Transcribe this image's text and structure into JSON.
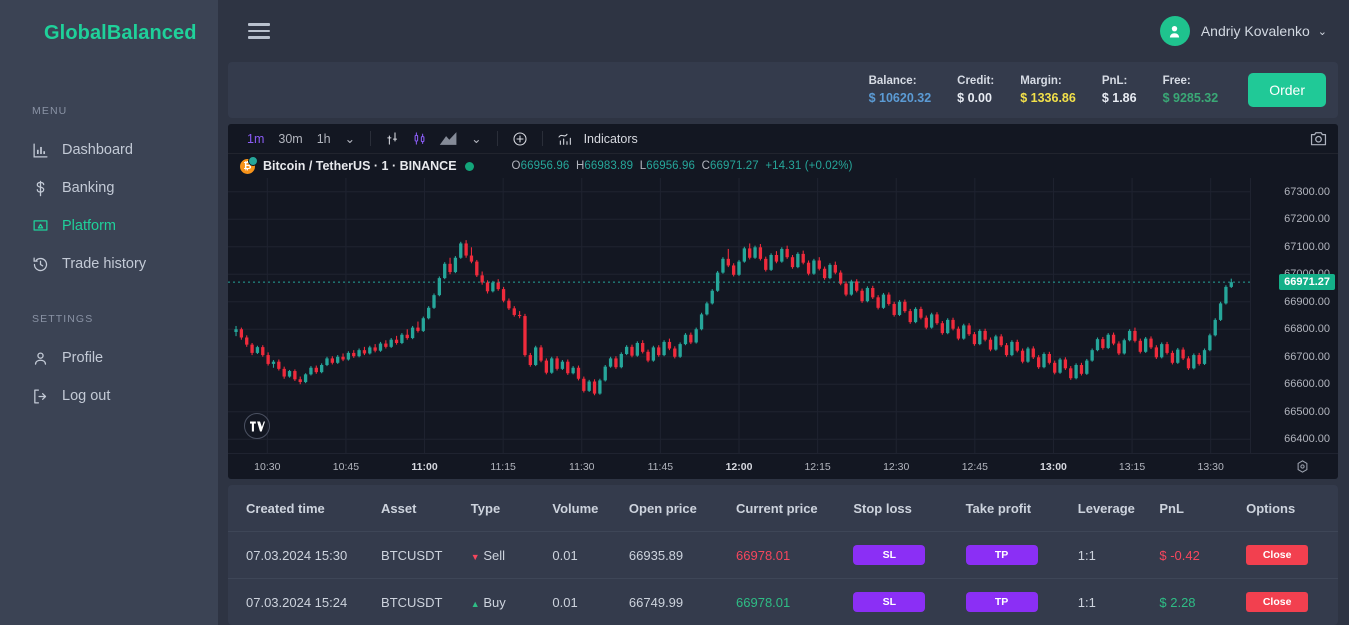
{
  "brand": {
    "name": "GlobalBalanced"
  },
  "header": {
    "menu_icon": "hamburger-icon",
    "user_name": "Andriy Kovalenko",
    "caret": "⌄"
  },
  "sidebar": {
    "sections": [
      {
        "label": "MENU"
      },
      {
        "label": "SETTINGS"
      }
    ],
    "menu_items": [
      {
        "label": "Dashboard",
        "icon": "bar-chart-icon",
        "active": false
      },
      {
        "label": "Banking",
        "icon": "dollar-icon",
        "active": false
      },
      {
        "label": "Platform",
        "icon": "monitor-icon",
        "active": true
      },
      {
        "label": "Trade history",
        "icon": "history-icon",
        "active": false
      }
    ],
    "settings_items": [
      {
        "label": "Profile",
        "icon": "user-icon",
        "active": false
      },
      {
        "label": "Log out",
        "icon": "logout-icon",
        "active": false
      }
    ]
  },
  "stats": {
    "items": [
      {
        "label": "Balance:",
        "value": "$ 10620.32",
        "color": "#5b9bd5"
      },
      {
        "label": "Credit:",
        "value": "$ 0.00",
        "color": "#e8ecf3"
      },
      {
        "label": "Margin:",
        "value": "$ 1336.86",
        "color": "#f2e04a"
      },
      {
        "label": "PnL:",
        "value": "$ 1.86",
        "color": "#e8ecf3"
      },
      {
        "label": "Free:",
        "value": "$ 9285.32",
        "color": "#3aa876"
      }
    ],
    "order_button": "Order"
  },
  "chart_toolbar": {
    "timeframes": [
      {
        "label": "1m",
        "active": true
      },
      {
        "label": "30m",
        "active": false
      },
      {
        "label": "1h",
        "active": false
      }
    ],
    "chevron": "⌄",
    "icons": [
      "compare-icon",
      "candlestick-icon",
      "area-chart-icon",
      "add-icon"
    ],
    "indicators_label": "Indicators",
    "indicators_icon": "indicators-icon",
    "camera_icon": "camera-icon"
  },
  "symbol": {
    "coin_icon": "bitcoin-icon",
    "name": "Bitcoin / TetherUS · 1 · BINANCE",
    "status": "market-open-dot",
    "ohlc": {
      "o_key": "O",
      "o": "66956.96",
      "h_key": "H",
      "h": "66983.89",
      "l_key": "L",
      "l": "66956.96",
      "c_key": "C",
      "c": "66971.27",
      "change": "+14.31 (+0.02%)"
    }
  },
  "chart_data": {
    "type": "candlestick",
    "title": "Bitcoin / TetherUS · 1 · BINANCE",
    "xlabel": "",
    "ylabel": "",
    "grid": true,
    "legend": "none",
    "ylim": [
      66350,
      67350
    ],
    "price_ticks": [
      "67300.00",
      "67200.00",
      "67100.00",
      "67000.00",
      "66900.00",
      "66800.00",
      "66700.00",
      "66600.00",
      "66500.00",
      "66400.00"
    ],
    "time_ticks": [
      {
        "label": "10:30",
        "bold": false
      },
      {
        "label": "10:45",
        "bold": false
      },
      {
        "label": "11:00",
        "bold": true
      },
      {
        "label": "11:15",
        "bold": false
      },
      {
        "label": "11:30",
        "bold": false
      },
      {
        "label": "11:45",
        "bold": false
      },
      {
        "label": "12:00",
        "bold": true
      },
      {
        "label": "12:15",
        "bold": false
      },
      {
        "label": "12:30",
        "bold": false
      },
      {
        "label": "12:45",
        "bold": false
      },
      {
        "label": "13:00",
        "bold": true
      },
      {
        "label": "13:15",
        "bold": false
      },
      {
        "label": "13:30",
        "bold": false
      }
    ],
    "current_price": 66971.27,
    "current_price_label": "66971.27",
    "up_color": "#26a69a",
    "down_color": "#ef2b3c",
    "background": "#131722",
    "candles": [
      [
        66790,
        66812,
        66775,
        66800
      ],
      [
        66800,
        66806,
        66762,
        66770
      ],
      [
        66770,
        66778,
        66736,
        66744
      ],
      [
        66744,
        66750,
        66706,
        66714
      ],
      [
        66714,
        66740,
        66710,
        66735
      ],
      [
        66735,
        66742,
        66700,
        66706
      ],
      [
        66706,
        66716,
        66668,
        66674
      ],
      [
        66674,
        66688,
        66660,
        66682
      ],
      [
        66682,
        66690,
        66650,
        66656
      ],
      [
        66656,
        66664,
        66620,
        66628
      ],
      [
        66628,
        66652,
        66624,
        66648
      ],
      [
        66648,
        66654,
        66612,
        66618
      ],
      [
        66618,
        66628,
        66600,
        66608
      ],
      [
        66608,
        66640,
        66604,
        66636
      ],
      [
        66636,
        66666,
        66632,
        66660
      ],
      [
        66660,
        66668,
        66638,
        66644
      ],
      [
        66644,
        66676,
        66640,
        66670
      ],
      [
        66670,
        66700,
        66666,
        66694
      ],
      [
        66694,
        66702,
        66672,
        66678
      ],
      [
        66678,
        66706,
        66674,
        66700
      ],
      [
        66700,
        66712,
        66684,
        66690
      ],
      [
        66690,
        66720,
        66686,
        66714
      ],
      [
        66714,
        66724,
        66696,
        66702
      ],
      [
        66702,
        66730,
        66698,
        66724
      ],
      [
        66724,
        66736,
        66706,
        66712
      ],
      [
        66712,
        66740,
        66708,
        66734
      ],
      [
        66734,
        66746,
        66716,
        66722
      ],
      [
        66722,
        66754,
        66718,
        66748
      ],
      [
        66748,
        66760,
        66730,
        66736
      ],
      [
        66736,
        66768,
        66732,
        66762
      ],
      [
        66762,
        66776,
        66744,
        66750
      ],
      [
        66750,
        66786,
        66746,
        66780
      ],
      [
        66780,
        66800,
        66762,
        66768
      ],
      [
        66768,
        66812,
        66764,
        66806
      ],
      [
        66806,
        66828,
        66788,
        66794
      ],
      [
        66794,
        66846,
        66790,
        66840
      ],
      [
        66840,
        66884,
        66836,
        66878
      ],
      [
        66878,
        66930,
        66874,
        66924
      ],
      [
        66924,
        66992,
        66920,
        66986
      ],
      [
        66986,
        67044,
        66982,
        67038
      ],
      [
        67038,
        67060,
        67000,
        67008
      ],
      [
        67008,
        67066,
        67004,
        67060
      ],
      [
        67060,
        67118,
        67056,
        67112
      ],
      [
        67112,
        67124,
        67060,
        67068
      ],
      [
        67068,
        67098,
        67040,
        67046
      ],
      [
        67046,
        67052,
        66990,
        66996
      ],
      [
        66996,
        67010,
        66962,
        66970
      ],
      [
        66970,
        66978,
        66930,
        66938
      ],
      [
        66938,
        66976,
        66934,
        66970
      ],
      [
        66970,
        66982,
        66940,
        66946
      ],
      [
        66946,
        66954,
        66898,
        66904
      ],
      [
        66904,
        66912,
        66870,
        66876
      ],
      [
        66876,
        66884,
        66846,
        66852
      ],
      [
        66852,
        66866,
        66840,
        66848
      ],
      [
        66848,
        66856,
        66700,
        66706
      ],
      [
        66706,
        66714,
        66664,
        66670
      ],
      [
        66670,
        66740,
        66666,
        66734
      ],
      [
        66734,
        66742,
        66680,
        66686
      ],
      [
        66686,
        66694,
        66636,
        66642
      ],
      [
        66642,
        66700,
        66638,
        66694
      ],
      [
        66694,
        66702,
        66650,
        66656
      ],
      [
        66656,
        66688,
        66652,
        66682
      ],
      [
        66682,
        66690,
        66634,
        66640
      ],
      [
        66640,
        66666,
        66636,
        66660
      ],
      [
        66660,
        66668,
        66614,
        66620
      ],
      [
        66620,
        66628,
        66570,
        66576
      ],
      [
        66576,
        66616,
        66572,
        66610
      ],
      [
        66610,
        66618,
        66560,
        66566
      ],
      [
        66566,
        66620,
        66562,
        66614
      ],
      [
        66614,
        66670,
        66610,
        66664
      ],
      [
        66664,
        66700,
        66660,
        66694
      ],
      [
        66694,
        66702,
        66656,
        66662
      ],
      [
        66662,
        66716,
        66658,
        66710
      ],
      [
        66710,
        66742,
        66706,
        66736
      ],
      [
        66736,
        66744,
        66698,
        66704
      ],
      [
        66704,
        66756,
        66700,
        66750
      ],
      [
        66750,
        66760,
        66712,
        66718
      ],
      [
        66718,
        66726,
        66680,
        66686
      ],
      [
        66686,
        66740,
        66682,
        66734
      ],
      [
        66734,
        66742,
        66700,
        66706
      ],
      [
        66706,
        66760,
        66702,
        66754
      ],
      [
        66754,
        66766,
        66724,
        66730
      ],
      [
        66730,
        66738,
        66694,
        66700
      ],
      [
        66700,
        66752,
        66696,
        66746
      ],
      [
        66746,
        66786,
        66742,
        66780
      ],
      [
        66780,
        66788,
        66746,
        66752
      ],
      [
        66752,
        66806,
        66748,
        66800
      ],
      [
        66800,
        66860,
        66796,
        66854
      ],
      [
        66854,
        66900,
        66850,
        66894
      ],
      [
        66894,
        66946,
        66890,
        66940
      ],
      [
        66940,
        67012,
        66936,
        67006
      ],
      [
        67006,
        67062,
        67002,
        67056
      ],
      [
        67056,
        67092,
        67026,
        67032
      ],
      [
        67032,
        67040,
        66992,
        66998
      ],
      [
        66998,
        67052,
        66994,
        67046
      ],
      [
        67046,
        67100,
        67042,
        67094
      ],
      [
        67094,
        67112,
        67054,
        67060
      ],
      [
        67060,
        67104,
        67056,
        67098
      ],
      [
        67098,
        67110,
        67050,
        67056
      ],
      [
        67056,
        67064,
        67010,
        67016
      ],
      [
        67016,
        67076,
        67012,
        67070
      ],
      [
        67070,
        67084,
        67040,
        67046
      ],
      [
        67046,
        67098,
        67042,
        67092
      ],
      [
        67092,
        67104,
        67056,
        67062
      ],
      [
        67062,
        67070,
        67020,
        67026
      ],
      [
        67026,
        67080,
        67022,
        67074
      ],
      [
        67074,
        67086,
        67036,
        67042
      ],
      [
        67042,
        67050,
        66996,
        67002
      ],
      [
        67002,
        67056,
        66998,
        67050
      ],
      [
        67050,
        67062,
        67014,
        67020
      ],
      [
        67020,
        67028,
        66980,
        66986
      ],
      [
        66986,
        67040,
        66982,
        67034
      ],
      [
        67034,
        67046,
        67000,
        67006
      ],
      [
        67006,
        67014,
        66960,
        66966
      ],
      [
        66966,
        66974,
        66920,
        66926
      ],
      [
        66926,
        66980,
        66922,
        66974
      ],
      [
        66974,
        66982,
        66934,
        66940
      ],
      [
        66940,
        66948,
        66896,
        66902
      ],
      [
        66902,
        66956,
        66898,
        66950
      ],
      [
        66950,
        66958,
        66910,
        66916
      ],
      [
        66916,
        66924,
        66872,
        66878
      ],
      [
        66878,
        66932,
        66874,
        66926
      ],
      [
        66926,
        66934,
        66886,
        66892
      ],
      [
        66892,
        66900,
        66846,
        66852
      ],
      [
        66852,
        66906,
        66848,
        66900
      ],
      [
        66900,
        66908,
        66860,
        66866
      ],
      [
        66866,
        66874,
        66820,
        66826
      ],
      [
        66826,
        66880,
        66822,
        66874
      ],
      [
        66874,
        66882,
        66836,
        66842
      ],
      [
        66842,
        66850,
        66800,
        66806
      ],
      [
        66806,
        66860,
        66802,
        66854
      ],
      [
        66854,
        66862,
        66816,
        66822
      ],
      [
        66822,
        66830,
        66780,
        66786
      ],
      [
        66786,
        66840,
        66782,
        66834
      ],
      [
        66834,
        66842,
        66796,
        66802
      ],
      [
        66802,
        66810,
        66760,
        66766
      ],
      [
        66766,
        66820,
        66762,
        66814
      ],
      [
        66814,
        66822,
        66776,
        66782
      ],
      [
        66782,
        66790,
        66740,
        66746
      ],
      [
        66746,
        66800,
        66742,
        66794
      ],
      [
        66794,
        66802,
        66756,
        66762
      ],
      [
        66762,
        66770,
        66720,
        66726
      ],
      [
        66726,
        66780,
        66722,
        66774
      ],
      [
        66774,
        66782,
        66736,
        66742
      ],
      [
        66742,
        66750,
        66700,
        66706
      ],
      [
        66706,
        66760,
        66702,
        66754
      ],
      [
        66754,
        66762,
        66716,
        66722
      ],
      [
        66722,
        66730,
        66676,
        66682
      ],
      [
        66682,
        66736,
        66678,
        66730
      ],
      [
        66730,
        66738,
        66692,
        66698
      ],
      [
        66698,
        66706,
        66656,
        66662
      ],
      [
        66662,
        66716,
        66658,
        66710
      ],
      [
        66710,
        66718,
        66672,
        66678
      ],
      [
        66678,
        66686,
        66636,
        66642
      ],
      [
        66642,
        66696,
        66638,
        66690
      ],
      [
        66690,
        66698,
        66652,
        66658
      ],
      [
        66658,
        66666,
        66616,
        66622
      ],
      [
        66622,
        66676,
        66618,
        66670
      ],
      [
        66670,
        66678,
        66632,
        66638
      ],
      [
        66638,
        66692,
        66634,
        66686
      ],
      [
        66686,
        66730,
        66682,
        66724
      ],
      [
        66724,
        66770,
        66720,
        66764
      ],
      [
        66764,
        66772,
        66726,
        66732
      ],
      [
        66732,
        66786,
        66728,
        66780
      ],
      [
        66780,
        66788,
        66742,
        66748
      ],
      [
        66748,
        66756,
        66706,
        66712
      ],
      [
        66712,
        66766,
        66708,
        66760
      ],
      [
        66760,
        66800,
        66756,
        66794
      ],
      [
        66794,
        66806,
        66752,
        66758
      ],
      [
        66758,
        66766,
        66712,
        66718
      ],
      [
        66718,
        66772,
        66714,
        66766
      ],
      [
        66766,
        66774,
        66728,
        66734
      ],
      [
        66734,
        66742,
        66692,
        66698
      ],
      [
        66698,
        66752,
        66694,
        66746
      ],
      [
        66746,
        66754,
        66708,
        66714
      ],
      [
        66714,
        66722,
        66672,
        66678
      ],
      [
        66678,
        66732,
        66674,
        66726
      ],
      [
        66726,
        66734,
        66688,
        66694
      ],
      [
        66694,
        66702,
        66652,
        66658
      ],
      [
        66658,
        66712,
        66654,
        66706
      ],
      [
        66706,
        66714,
        66668,
        66674
      ],
      [
        66674,
        66730,
        66670,
        66724
      ],
      [
        66724,
        66784,
        66720,
        66778
      ],
      [
        66778,
        66840,
        66774,
        66834
      ],
      [
        66834,
        66900,
        66830,
        66894
      ],
      [
        66894,
        66960,
        66890,
        66954
      ],
      [
        66954,
        66984,
        66950,
        66971
      ]
    ]
  },
  "table": {
    "columns": [
      "Created time",
      "Asset",
      "Type",
      "Volume",
      "Open price",
      "Current price",
      "Stop loss",
      "Take profit",
      "Leverage",
      "PnL",
      "Options"
    ],
    "rows": [
      {
        "created_time": "07.03.2024 15:30",
        "asset": "BTCUSDT",
        "type": "Sell",
        "type_direction": "down",
        "volume": "0.01",
        "open_price": "66935.89",
        "current_price": "66978.01",
        "current_price_color": "#f6465d",
        "stop_loss": "SL",
        "take_profit": "TP",
        "leverage": "1:1",
        "pnl": "$ -0.42",
        "pnl_color": "#f6465d",
        "close": "Close"
      },
      {
        "created_time": "07.03.2024 15:24",
        "asset": "BTCUSDT",
        "type": "Buy",
        "type_direction": "up",
        "volume": "0.01",
        "open_price": "66749.99",
        "current_price": "66978.01",
        "current_price_color": "#2ebd85",
        "stop_loss": "SL",
        "take_profit": "TP",
        "leverage": "1:1",
        "pnl": "$ 2.28",
        "pnl_color": "#2ebd85",
        "close": "Close"
      }
    ]
  }
}
